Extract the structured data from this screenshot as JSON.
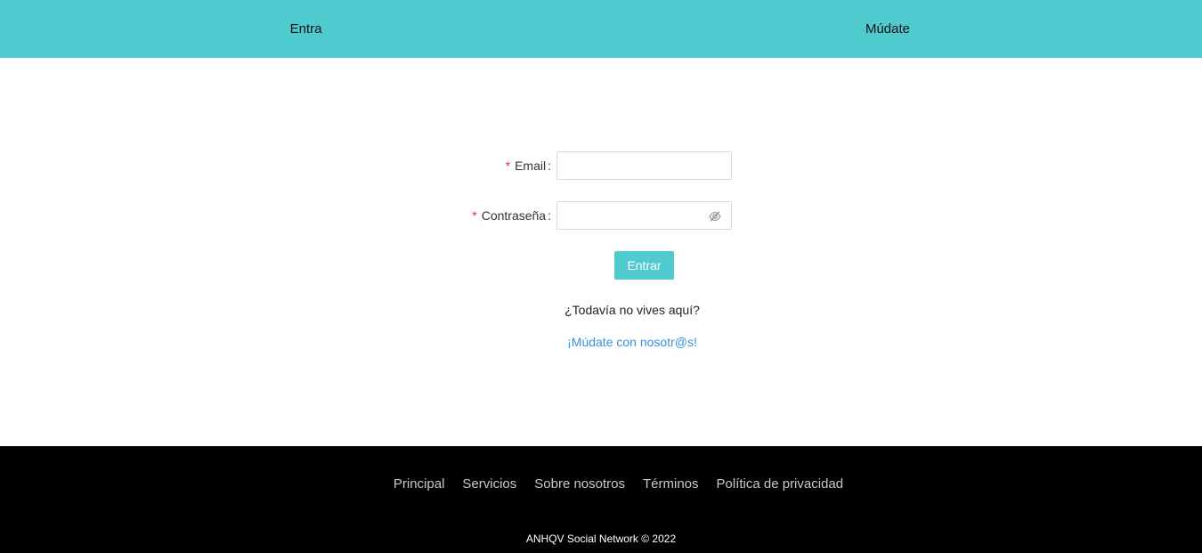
{
  "nav": {
    "login_tab": "Entra",
    "register_tab": "Múdate"
  },
  "form": {
    "email_label": "Email",
    "password_label": "Contraseña",
    "required_mark": "*",
    "colon": ":",
    "email_value": "",
    "password_value": "",
    "submit_label": "Entrar"
  },
  "signup": {
    "question": "¿Todavía no vives aquí?",
    "link": "¡Múdate con nosotr@s!"
  },
  "footer": {
    "links": [
      "Principal",
      "Servicios",
      "Sobre nosotros",
      "Términos",
      "Política de privacidad"
    ],
    "copyright": "ANHQV Social Network © 2022"
  },
  "colors": {
    "accent": "#4fcbd0",
    "link": "#3a8fe0",
    "required": "#e0303a",
    "footer_bg": "#000000"
  },
  "icons": {
    "password_toggle": "eye-invisible-icon"
  }
}
